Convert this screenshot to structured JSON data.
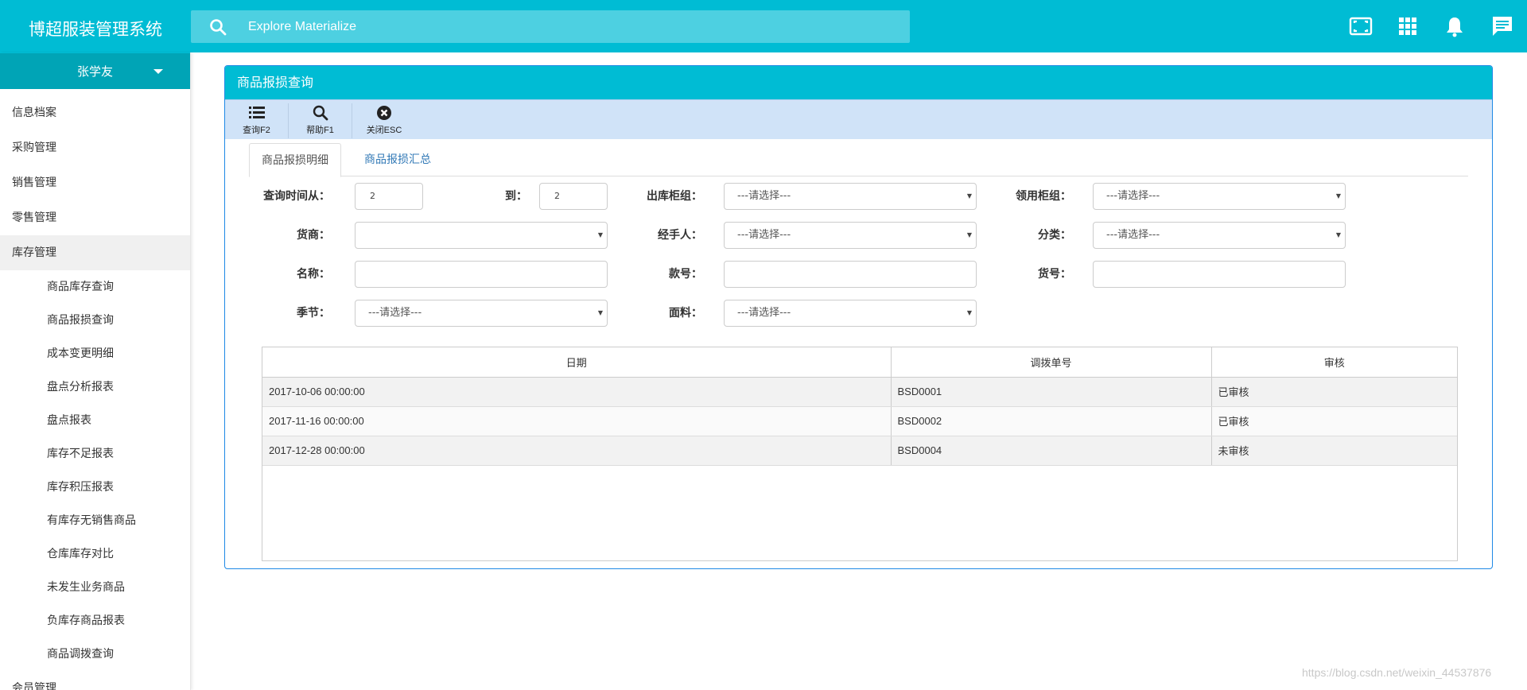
{
  "header": {
    "brand": "博超服装管理系统",
    "search_placeholder": "Explore Materialize",
    "icons": [
      "fullscreen-icon",
      "apps-grid-icon",
      "bell-icon",
      "message-icon"
    ]
  },
  "sidebar": {
    "user_name": "张学友",
    "items": [
      {
        "label": "信息档案"
      },
      {
        "label": "采购管理"
      },
      {
        "label": "销售管理"
      },
      {
        "label": "零售管理"
      },
      {
        "label": "库存管理"
      }
    ],
    "sub_items": [
      {
        "label": "商品库存查询"
      },
      {
        "label": "商品报损查询"
      },
      {
        "label": "成本变更明细"
      },
      {
        "label": "盘点分析报表"
      },
      {
        "label": "盘点报表"
      },
      {
        "label": "库存不足报表"
      },
      {
        "label": "库存积压报表"
      },
      {
        "label": "有库存无销售商品"
      },
      {
        "label": "仓库库存对比"
      },
      {
        "label": "未发生业务商品"
      },
      {
        "label": "负库存商品报表"
      },
      {
        "label": "商品调拨查询"
      }
    ],
    "cut_item": "会员管理"
  },
  "panel": {
    "title": "商品报损查询",
    "toolbar": {
      "query": "查询F2",
      "help": "帮助F1",
      "close": "关闭ESC"
    },
    "tabs": {
      "detail": "商品报损明细",
      "summary": "商品报损汇总"
    },
    "form": {
      "time_from_label": "查询时间从：",
      "time_from_value": "2",
      "to_label": "到：",
      "to_value": "2",
      "out_counter_label": "出库柜组：",
      "out_counter_value": "---请选择---",
      "use_counter_label": "领用柜组：",
      "use_counter_value": "---请选择---",
      "supplier_label": "货商：",
      "supplier_value": "",
      "handler_label": "经手人：",
      "handler_value": "---请选择---",
      "category_label": "分类：",
      "category_value": "---请选择---",
      "name_label": "名称：",
      "name_value": "",
      "style_no_label": "款号：",
      "style_no_value": "",
      "item_no_label": "货号：",
      "item_no_value": "",
      "season_label": "季节：",
      "season_value": "---请选择---",
      "fabric_label": "面料：",
      "fabric_value": "---请选择---"
    },
    "table": {
      "headers": [
        "日期",
        "调拨单号",
        "审核"
      ],
      "rows": [
        [
          "2017-10-06 00:00:00",
          "BSD0001",
          "已审核"
        ],
        [
          "2017-11-16 00:00:00",
          "BSD0002",
          "已审核"
        ],
        [
          "2017-12-28 00:00:00",
          "BSD0004",
          "未审核"
        ]
      ]
    }
  },
  "watermark": "https://blog.csdn.net/weixin_44537876"
}
